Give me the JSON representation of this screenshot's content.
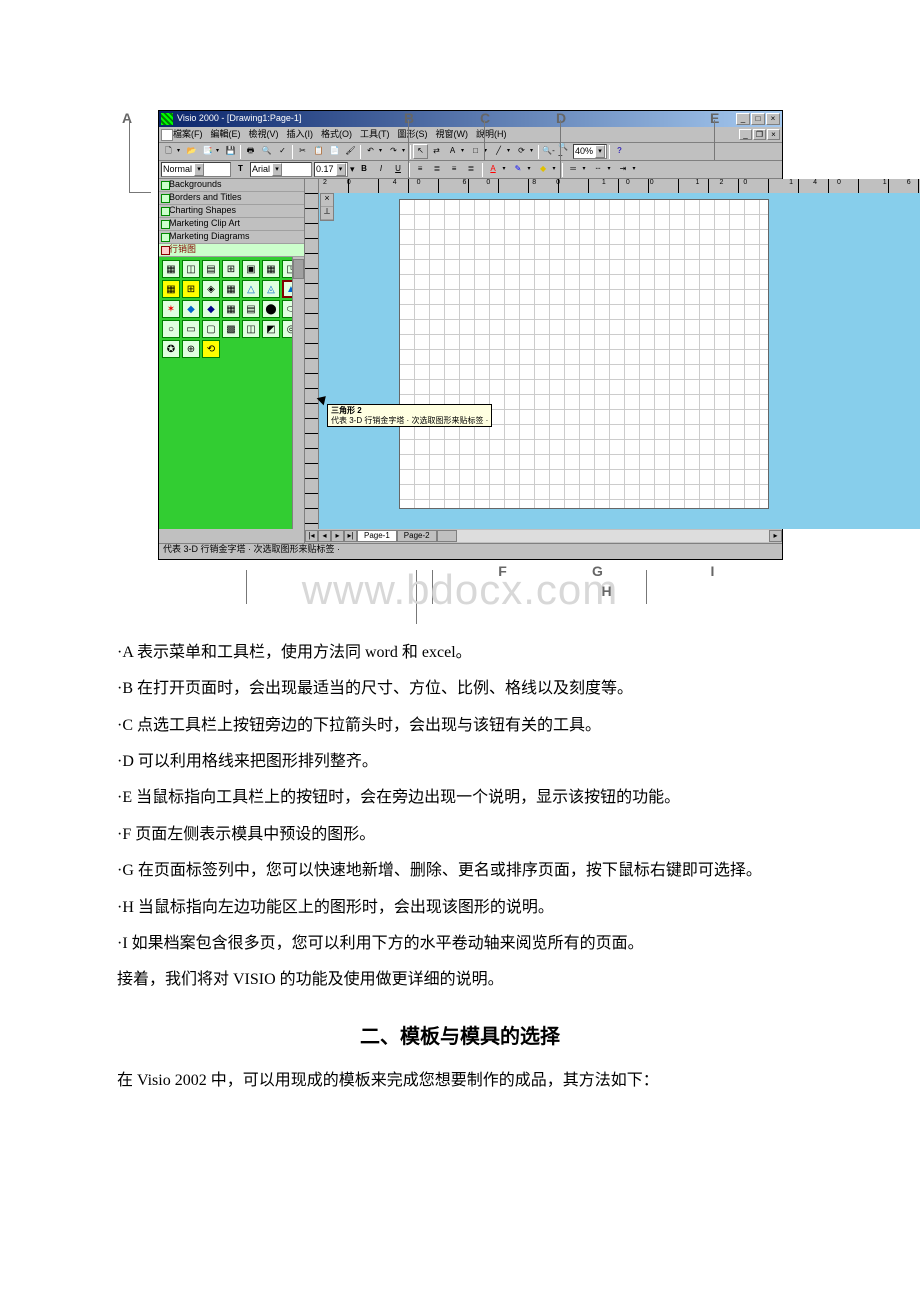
{
  "app": {
    "title": "Visio 2000 - [Drawing1:Page-1]",
    "menus": [
      "檔案(F)",
      "編輯(E)",
      "檢視(V)",
      "插入(I)",
      "格式(O)",
      "工具(T)",
      "圖形(S)",
      "視窗(W)",
      "說明(H)"
    ],
    "zoom": "40%",
    "style_name": "Normal",
    "font_name": "Arial",
    "font_size": "0.17",
    "stencils": [
      "Backgrounds",
      "Borders and Titles",
      "Charting Shapes",
      "Marketing Clip Art",
      "Marketing Diagrams",
      "行销图"
    ],
    "tooltip": {
      "title": "三角形 2",
      "body": "代表 3-D 行销金字塔 ·\n次选取图形来贴标签 ·"
    },
    "page_tabs": {
      "active": "Page-1",
      "inactive": "Page-2"
    },
    "status": "代表 3-D 行销金字塔 · 次选取图形来贴标签 ·"
  },
  "markers": {
    "A": "A",
    "B": "B",
    "C": "C",
    "D": "D",
    "E": "E",
    "F": "F",
    "G": "G",
    "H": "H",
    "I": "I"
  },
  "watermark": "www.bdocx.com",
  "doc": {
    "pA": "·A 表示菜单和工具栏，使用方法同 word 和 excel。",
    "pB": "·B 在打开页面时，会出现最适当的尺寸、方位、比例、格线以及刻度等。",
    "pC": "·C 点选工具栏上按钮旁边的下拉箭头时，会出现与该钮有关的工具。",
    "pD": "·D 可以利用格线来把图形排列整齐。",
    "pE": "·E 当鼠标指向工具栏上的按钮时，会在旁边出现一个说明，显示该按钮的功能。",
    "pF": "·F 页面左侧表示模具中预设的图形。",
    "pG": "·G 在页面标签列中，您可以快速地新增、删除、更名或排序页面，按下鼠标右键即可选择。",
    "pH": "·H 当鼠标指向左边功能区上的图形时，会出现该图形的说明。",
    "pI": "·I 如果档案包含很多页，您可以利用下方的水平卷动轴来阅览所有的页面。",
    "pNext": "接着，我们将对 VISIO 的功能及使用做更详细的说明。",
    "h2": "二、模板与模具的选择",
    "pIntro2": "在 Visio 2002 中，可以用现成的模板来完成您想要制作的成品，其方法如下："
  }
}
